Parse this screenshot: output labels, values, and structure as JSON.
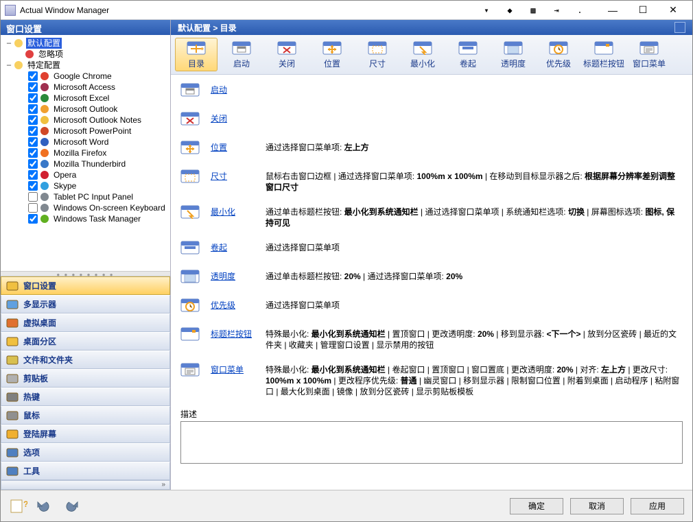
{
  "window": {
    "title": "Actual Window Manager"
  },
  "left_header": "窗口设置",
  "tree": {
    "root": {
      "label": "默认配置",
      "selected": true
    },
    "ignore": {
      "label": "忽略项"
    },
    "specific": {
      "label": "特定配置"
    },
    "apps": [
      {
        "label": "Google Chrome",
        "checked": true,
        "color": "#e04030"
      },
      {
        "label": "Microsoft Access",
        "checked": true,
        "color": "#a03050"
      },
      {
        "label": "Microsoft Excel",
        "checked": true,
        "color": "#2a8a3a"
      },
      {
        "label": "Microsoft Outlook",
        "checked": true,
        "color": "#f0a030"
      },
      {
        "label": "Microsoft Outlook Notes",
        "checked": true,
        "color": "#f0c040"
      },
      {
        "label": "Microsoft PowerPoint",
        "checked": true,
        "color": "#d04828"
      },
      {
        "label": "Microsoft Word",
        "checked": true,
        "color": "#3060c0"
      },
      {
        "label": "Mozilla Firefox",
        "checked": true,
        "color": "#f07020"
      },
      {
        "label": "Mozilla Thunderbird",
        "checked": true,
        "color": "#3878c8"
      },
      {
        "label": "Opera",
        "checked": true,
        "color": "#d02030"
      },
      {
        "label": "Skype",
        "checked": true,
        "color": "#30a0e0"
      },
      {
        "label": "Tablet PC Input Panel",
        "checked": false,
        "color": "#808890"
      },
      {
        "label": "Windows On-screen Keyboard",
        "checked": false,
        "color": "#808890"
      },
      {
        "label": "Windows Task Manager",
        "checked": true,
        "color": "#60b020"
      }
    ]
  },
  "nav": [
    {
      "label": "窗口设置",
      "active": true
    },
    {
      "label": "多显示器"
    },
    {
      "label": "虚拟桌面"
    },
    {
      "label": "桌面分区"
    },
    {
      "label": "文件和文件夹"
    },
    {
      "label": "剪贴板"
    },
    {
      "label": "热键"
    },
    {
      "label": "鼠标"
    },
    {
      "label": "登陆屏幕"
    },
    {
      "label": "选项"
    },
    {
      "label": "工具"
    }
  ],
  "breadcrumb": "默认配置 > 目录",
  "toolbar": [
    {
      "label": "目录",
      "active": true
    },
    {
      "label": "启动"
    },
    {
      "label": "关闭"
    },
    {
      "label": "位置"
    },
    {
      "label": "尺寸"
    },
    {
      "label": "最小化"
    },
    {
      "label": "卷起"
    },
    {
      "label": "透明度"
    },
    {
      "label": "优先级"
    },
    {
      "label": "标题栏按钮"
    },
    {
      "label": "窗口菜单"
    }
  ],
  "sections": [
    {
      "link": "启动",
      "desc": ""
    },
    {
      "link": "关闭",
      "desc": ""
    },
    {
      "link": "位置",
      "desc": "通过选择窗口菜单项: <b>左上方</b>"
    },
    {
      "link": "尺寸",
      "desc": "鼠标右击窗口边框 | 通过选择窗口菜单项: <b>100%m x 100%m</b> | 在移动到目标显示器之后: <b>根据屏幕分辨率差别调整窗口尺寸</b>"
    },
    {
      "link": "最小化",
      "desc": "通过单击标题栏按钮: <b>最小化到系统通知栏</b> | 通过选择窗口菜单项 | 系统通知栏选项: <b>切换</b> | 屏幕图标选项: <b>图标, 保持可见</b>"
    },
    {
      "link": "卷起",
      "desc": "通过选择窗口菜单项"
    },
    {
      "link": "透明度",
      "desc": "通过单击标题栏按钮: <b>20%</b> | 通过选择窗口菜单项: <b>20%</b>"
    },
    {
      "link": "优先级",
      "desc": "通过选择窗口菜单项"
    },
    {
      "link": "标题栏按钮",
      "desc": "特殊最小化: <b>最小化到系统通知栏</b> | 置顶窗口 | 更改透明度: <b>20%</b> | 移到显示器: <b>&lt;下一个&gt;</b> | 放到分区瓷砖 | 最近的文件夹 | 收藏夹 | 管理窗口设置 | 显示禁用的按钮"
    },
    {
      "link": "窗口菜单",
      "desc": "特殊最小化: <b>最小化到系统通知栏</b> | 卷起窗口 | 置顶窗口 | 窗口置底 | 更改透明度: <b>20%</b> | 对齐: <b>左上方</b> | 更改尺寸: <b>100%m x 100%m</b> | 更改程序优先级: <b>普通</b> | 幽灵窗口 | 移到显示器 | 限制窗口位置 | 附着到桌面 | 启动程序 | 粘附窗口 | 最大化到桌面 | 镜像 | 放到分区瓷砖 | 显示剪贴板模板"
    }
  ],
  "desc_label": "描述",
  "buttons": {
    "ok": "确定",
    "cancel": "取消",
    "apply": "应用"
  }
}
